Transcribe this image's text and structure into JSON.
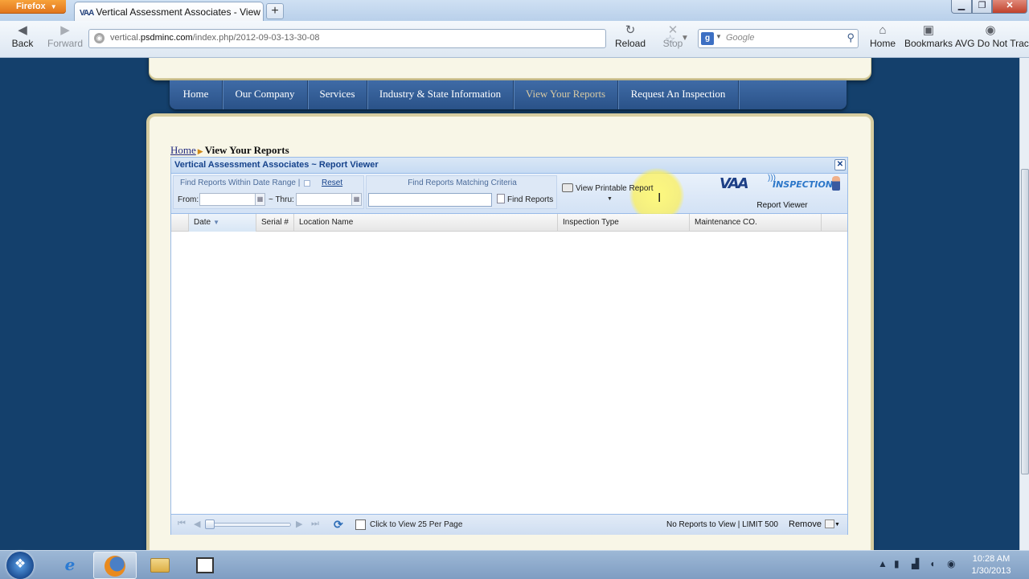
{
  "browser": {
    "app_button": "Firefox",
    "tab_title": "Vertical Assessment Associates - View Y...",
    "tab_favicon": "VAA",
    "url_prefix": "vertical.",
    "url_domain": "psdminc.com",
    "url_path": "/index.php/2012-09-03-13-30-08",
    "nav": {
      "back": "Back",
      "forward": "Forward",
      "reload": "Reload",
      "stop": "Stop",
      "home": "Home",
      "bookmarks": "Bookmarks",
      "avg": "AVG Do Not Track"
    },
    "search_placeholder": "Google",
    "search_engine_letter": "g"
  },
  "site": {
    "menu": [
      {
        "label": "Home"
      },
      {
        "label": "Our Company"
      },
      {
        "label": "Services"
      },
      {
        "label": "Industry & State Information"
      },
      {
        "label": "View Your Reports",
        "active": true
      },
      {
        "label": "Request An Inspection"
      }
    ],
    "breadcrumb": {
      "home": "Home",
      "current": "View Your Reports"
    }
  },
  "viewer": {
    "title": "Vertical Assessment Associates ~ Report Viewer",
    "date_group_label": "Find Reports Within Date Range |",
    "reset_label": "Reset",
    "from_label": "From:",
    "thru_label": "~ Thru:",
    "criteria_label": "Find Reports Matching Criteria",
    "criteria_value": "",
    "find_button": "Find Reports",
    "printable_button": "View Printable Report",
    "logo_text": "VAA",
    "logo_sub": "INSPECTION",
    "logo_caption": "Report Viewer",
    "columns": [
      "Date",
      "Serial #",
      "Location Name",
      "Inspection Type",
      "Maintenance CO."
    ],
    "rows": [],
    "pager": {
      "per_page_label": "Click to View 25 Per Page",
      "status": "No Reports to View | LIMIT 500",
      "remove_label": "Remove"
    }
  },
  "taskbar": {
    "time": "10:28 AM",
    "date": "1/30/2013"
  },
  "colors": {
    "page_background": "#14406c",
    "menu_bar": "#2f5a94",
    "panel_background": "#f8f6e7",
    "viewer_title_text": "#15428b",
    "firefox_button": "#e88a2a"
  },
  "icons": [
    "back-arrow-icon",
    "forward-arrow-icon",
    "reload-icon",
    "stop-icon",
    "home-icon",
    "bookmarks-icon",
    "star-icon",
    "search-icon",
    "calendar-icon",
    "printer-icon",
    "refresh-icon",
    "close-icon",
    "windows-start-icon",
    "internet-explorer-icon",
    "firefox-icon",
    "folder-icon"
  ]
}
